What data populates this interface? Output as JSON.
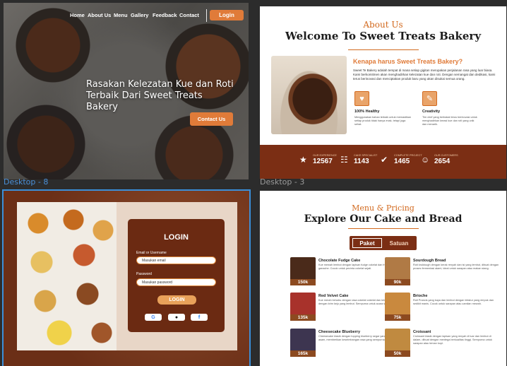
{
  "frames": {
    "desktop_8_label": "Desktop - 8",
    "desktop_3_label": "Desktop - 3"
  },
  "hero": {
    "nav": [
      "Home",
      "About Us",
      "Menu",
      "Gallery",
      "Feedback",
      "Contact"
    ],
    "login_button": "Login",
    "title": "Rasakan Kelezatan Kue dan Roti Terbaik Dari Sweet Treats Bakery",
    "contact_button": "Contact Us"
  },
  "about": {
    "kicker": "About Us",
    "heading": "Welcome To Sweet Treats Bakery",
    "subheading": "Kenapa harus Sweet Treats Bakery?",
    "body": "Sweet Te Bakery adalah tempat di mana setiap gigitan merupakan perjalanan rasa yang luar biasa. Kami berkomitmen akan menghadirkan kelezatan kue dan roti. Dengan semangat dan dedikasi, kami terus berinovasi dan menciptakan produk baru yang akan disukai semua orang.",
    "features": [
      {
        "icon": "heart-monitor-icon",
        "title": "100% Healthy",
        "text": "Menggunakan bahan terbaik untuk memastikan setiap produk tidak hanya enak, tetapi juga sehat."
      },
      {
        "icon": "creativity-icon",
        "title": "Creativity",
        "text": "Tim chef yang berbakat terus berinovasi untuk menghadirkan kreasi kue dan roti yang unik dan menarik."
      }
    ],
    "stats": [
      {
        "icon": "star-icon",
        "label": "OUR EXPERIENCE",
        "value": "12567"
      },
      {
        "icon": "users-icon",
        "label": "CAKE SPECIALIST",
        "value": "1143"
      },
      {
        "icon": "check-icon",
        "label": "COMPLETE PROJECT",
        "value": "1465"
      },
      {
        "icon": "smile-icon",
        "label": "OUR CUSTOMERS",
        "value": "2654"
      }
    ]
  },
  "login": {
    "title": "LOGIN",
    "email_label": "Email or Username",
    "email_placeholder": "Masukan email",
    "password_label": "Password",
    "password_placeholder": "Masukan password",
    "submit": "LOGIN",
    "social": [
      "google-icon",
      "apple-icon",
      "facebook-icon"
    ]
  },
  "menu": {
    "kicker": "Menu & Pricing",
    "heading": "Explore Our Cake and Bread",
    "toggle_selected": "Paket",
    "toggle_other": "Satuan",
    "items": [
      {
        "name": "Chocolate Fudge Cake",
        "price": "150k",
        "desc": "Kue mewah lembut dengan lapisan fudge cokelat dan frosting cokelat ganache. Cocok untuk pecinta cokelat sejati.",
        "color": "#4a2a1a"
      },
      {
        "name": "Sourdough Bread",
        "price": "90k",
        "desc": "Roti kruktough dengan kerak renyah dan isi yang lembut, dibuat dengan proses fermentasi alami, ideal untuk sarapan atau makan siang.",
        "color": "#b07a45"
      },
      {
        "name": "Red Velvet Cake",
        "price": "135k",
        "desc": "Kue merah beludru dengan rasa cokelat cokelat dan krim, dilapisi dengan krim keju yang lembut. Sempurna untuk acara spesial.",
        "color": "#a8322b"
      },
      {
        "name": "Brioche",
        "price": "75k",
        "desc": "Roti Prancis yang kaya dan lembut dengan tekstur yang empuk dan sedikit manis. Cocok untuk sarapan atau camilan mewah.",
        "color": "#c9893e"
      },
      {
        "name": "Cheesecake Blueberry",
        "price": "165k",
        "desc": "Cheesecake klasik dengan topping blueberry segar yang manis dan asam, memberikan keseimbangan rasa yang sempurna.",
        "color": "#3d3550"
      },
      {
        "name": "Croissant",
        "price": "50k",
        "desc": "Croissant klasik dengan lapisan yang renyah di luar dan lembut di dalam, dibuat dengan mentega berkualitas tinggi. Sempurna untuk sarapan atau teman kopi.",
        "color": "#c08a40"
      }
    ]
  },
  "colors": {
    "accent": "#e07b39",
    "brand_brown": "#7b2e14",
    "selection": "#3b8fd8"
  }
}
